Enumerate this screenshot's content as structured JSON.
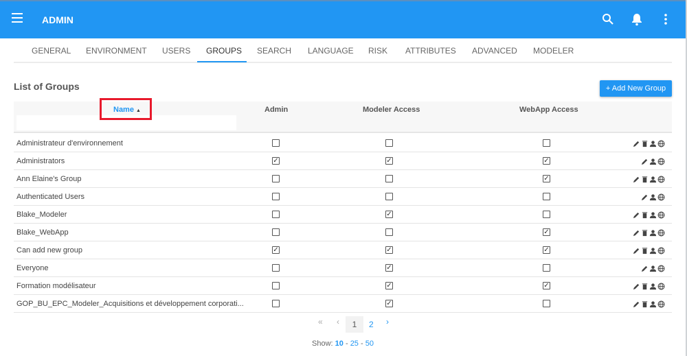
{
  "app": {
    "title": "ADMIN"
  },
  "tabs": [
    "GENERAL",
    "ENVIRONMENT",
    "USERS",
    "GROUPS",
    "SEARCH",
    "LANGUAGE",
    "RISK",
    "ATTRIBUTES",
    "ADVANCED",
    "MODELER"
  ],
  "active_tab": "GROUPS",
  "section_title": "List of Groups",
  "add_button": "+ Add New Group",
  "columns": {
    "name": "Name",
    "sort": "▲",
    "admin": "Admin",
    "modeler": "Modeler Access",
    "webapp": "WebApp Access"
  },
  "filter": {
    "value": "",
    "placeholder": ""
  },
  "rows": [
    {
      "name": "Administrateur d'environnement",
      "admin": false,
      "modeler": false,
      "webapp": false,
      "deletable": true
    },
    {
      "name": "Administrators",
      "admin": true,
      "modeler": true,
      "webapp": true,
      "deletable": false
    },
    {
      "name": "Ann Elaine's Group",
      "admin": false,
      "modeler": false,
      "webapp": true,
      "deletable": true
    },
    {
      "name": "Authenticated Users",
      "admin": false,
      "modeler": false,
      "webapp": false,
      "deletable": false
    },
    {
      "name": "Blake_Modeler",
      "admin": false,
      "modeler": true,
      "webapp": false,
      "deletable": true
    },
    {
      "name": "Blake_WebApp",
      "admin": false,
      "modeler": false,
      "webapp": true,
      "deletable": true
    },
    {
      "name": "Can add new group",
      "admin": true,
      "modeler": true,
      "webapp": true,
      "deletable": true
    },
    {
      "name": "Everyone",
      "admin": false,
      "modeler": true,
      "webapp": false,
      "deletable": false
    },
    {
      "name": "Formation modélisateur",
      "admin": false,
      "modeler": true,
      "webapp": true,
      "deletable": true
    },
    {
      "name": "GOP_BU_EPC_Modeler_Acquisitions et développement corporati...",
      "admin": false,
      "modeler": true,
      "webapp": false,
      "deletable": true
    }
  ],
  "pagination": {
    "first": "«",
    "prev": "‹",
    "pages": [
      "1",
      "2"
    ],
    "current": "1",
    "next": "›"
  },
  "show": {
    "label": "Show:",
    "options": [
      "10",
      "25",
      "50"
    ],
    "selected": "10",
    "sep": "-"
  },
  "colors": {
    "primary": "#2196f3",
    "highlight": "#e8192c"
  }
}
